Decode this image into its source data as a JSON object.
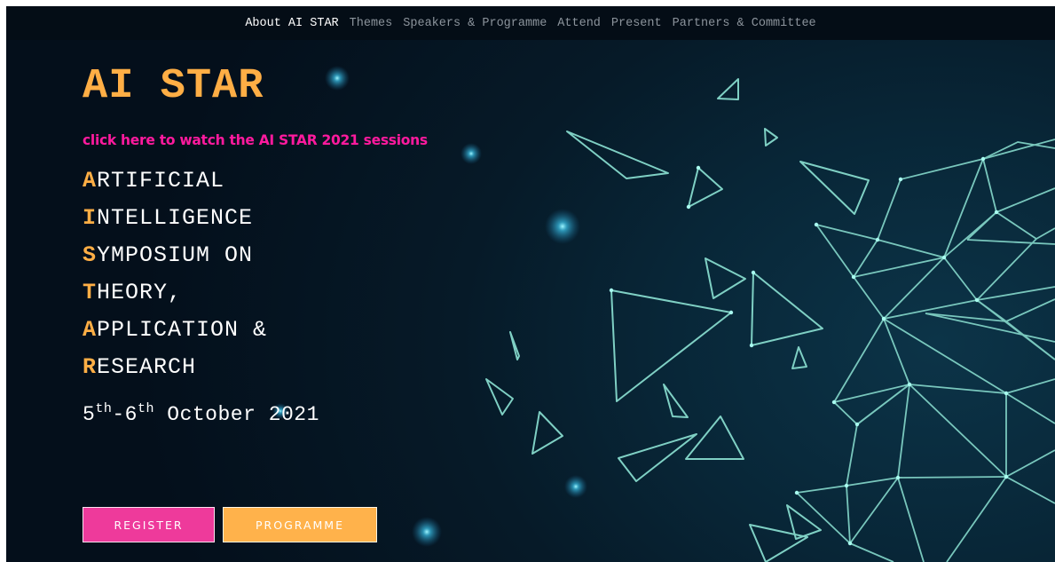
{
  "nav": {
    "items": [
      {
        "label": "About AI STAR",
        "active": true
      },
      {
        "label": "Themes",
        "active": false
      },
      {
        "label": "Speakers & Programme",
        "active": false
      },
      {
        "label": "Attend",
        "active": false
      },
      {
        "label": "Present",
        "active": false
      },
      {
        "label": "Partners & Committee",
        "active": false
      }
    ]
  },
  "hero": {
    "title": "AI STAR",
    "watch_link": "click here to watch the AI STAR 2021 sessions",
    "acronym_lines": [
      {
        "first": "A",
        "rest": "RTIFICIAL"
      },
      {
        "first": "I",
        "rest": "NTELLIGENCE"
      },
      {
        "first": "S",
        "rest": "YMPOSIUM ON"
      },
      {
        "first": "T",
        "rest": "HEORY,"
      },
      {
        "first": "A",
        "rest": "PPLICATION &"
      },
      {
        "first": "R",
        "rest": "ESEARCH"
      }
    ],
    "dates": {
      "day1": "5",
      "sup1": "th",
      "sep": "-",
      "day2": "6",
      "sup2": "th",
      "month_year": " October 2021"
    }
  },
  "buttons": {
    "register": "REGISTER",
    "programme": "PROGRAMME"
  },
  "colors": {
    "accent_orange": "#ffae45",
    "accent_pink": "#ff1a9e",
    "register_bg": "#ee3a9b",
    "programme_bg": "#ffb24b",
    "background": "#061a28",
    "line_art": "#7fd0c4"
  }
}
